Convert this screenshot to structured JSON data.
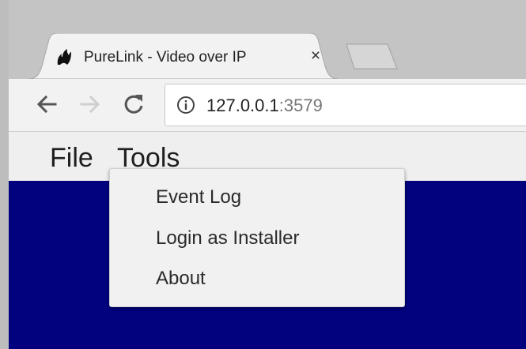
{
  "browser": {
    "tab": {
      "title": "PureLink - Video over IP",
      "close_glyph": "×",
      "favicon": "purelink-logo-icon"
    },
    "nav": {
      "back_icon": "arrow-left-icon",
      "forward_icon": "arrow-right-icon",
      "reload_icon": "reload-icon"
    },
    "address": {
      "host": "127.0.0.1",
      "port": ":3579",
      "info_icon": "info-icon"
    }
  },
  "app": {
    "menubar": {
      "file": "File",
      "tools": "Tools"
    },
    "tools_menu": {
      "items": [
        "Event Log",
        "Login as Installer",
        "About"
      ]
    },
    "colors": {
      "content_background": "#02027e"
    }
  }
}
